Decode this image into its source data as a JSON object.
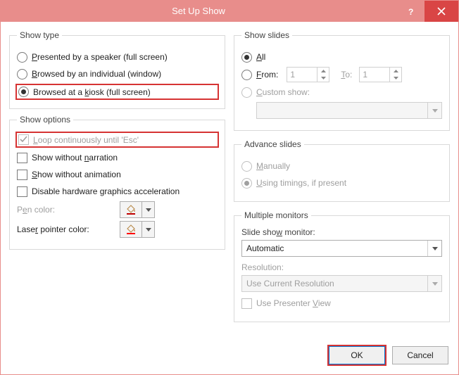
{
  "title": "Set Up Show",
  "groups": {
    "show_type": "Show type",
    "show_options": "Show options",
    "show_slides": "Show slides",
    "advance_slides": "Advance slides",
    "multiple_monitors": "Multiple monitors"
  },
  "show_type": {
    "presented_pre": "",
    "presented_u": "P",
    "presented_post": "resented by a speaker (full screen)",
    "browsed_indiv_pre": "",
    "browsed_indiv_u": "B",
    "browsed_indiv_post": "rowsed by an individual (window)",
    "kiosk_pre": "Browsed at a ",
    "kiosk_u": "k",
    "kiosk_post": "iosk (full screen)"
  },
  "show_options": {
    "loop_pre": "",
    "loop_u": "L",
    "loop_post": "oop continuously until 'Esc'",
    "narration_pre": "Show without ",
    "narration_u": "n",
    "narration_post": "arration",
    "animation_pre": "",
    "animation_u": "S",
    "animation_post": "how without animation",
    "graphics_pre": "Disable hardware ",
    "graphics_u": "g",
    "graphics_post": "raphics acceleration",
    "pen_pre": "P",
    "pen_u": "e",
    "pen_post": "n color:",
    "laser_pre": "Lase",
    "laser_u": "r",
    "laser_post": " pointer color:"
  },
  "show_slides": {
    "all_u": "A",
    "all_post": "ll",
    "from_u": "F",
    "from_post": "rom:",
    "from_val": "1",
    "to_u": "T",
    "to_post": "o:",
    "to_val": "1",
    "custom_u": "C",
    "custom_post": "ustom show:"
  },
  "advance": {
    "manual_u": "M",
    "manual_post": "anually",
    "timings_u": "U",
    "timings_post": "sing timings, if present"
  },
  "monitors": {
    "monitor_pre": "Slide sho",
    "monitor_u": "w",
    "monitor_post": " monitor:",
    "monitor_val": "Automatic",
    "resolution_label": "Resolution:",
    "resolution_val": "Use Current Resolution",
    "presenter_pre": "Use Presenter ",
    "presenter_u": "V",
    "presenter_post": "iew"
  },
  "buttons": {
    "ok": "OK",
    "cancel": "Cancel"
  }
}
